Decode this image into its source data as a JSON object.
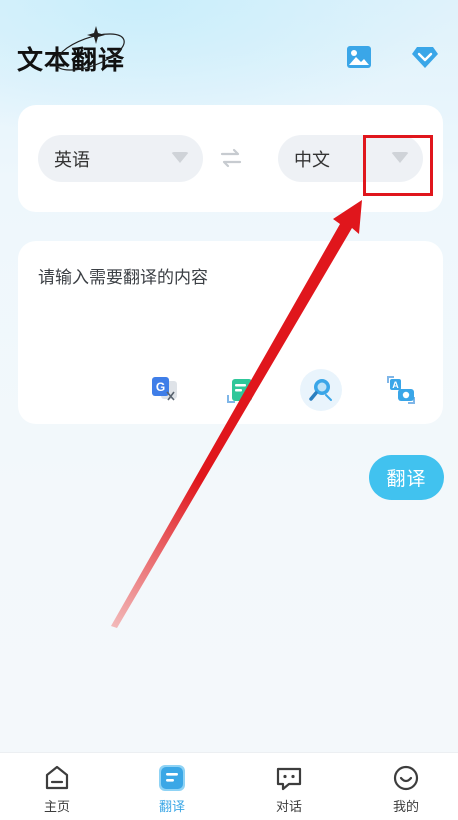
{
  "header": {
    "title": "文本翻译",
    "icons": [
      "image-icon",
      "vip-diamond-icon"
    ]
  },
  "lang_card": {
    "source_lang": "英语",
    "target_lang": "中文",
    "swap_icon": "swap-arrows-icon"
  },
  "input_card": {
    "placeholder": "请输入需要翻译的内容",
    "tools": [
      "google-translate-icon",
      "text-scan-icon",
      "search-icon",
      "photo-translate-icon"
    ]
  },
  "translate_button": {
    "label": "翻译"
  },
  "tabbar": {
    "tabs": [
      {
        "label": "主页",
        "icon": "home-icon"
      },
      {
        "label": "翻译",
        "icon": "translate-icon",
        "active": true
      },
      {
        "label": "对话",
        "icon": "chat-icon"
      },
      {
        "label": "我的",
        "icon": "profile-icon"
      }
    ]
  },
  "colors": {
    "accent": "#41c2ef",
    "annotation": "#e0161c",
    "tab_active": "#3ba7e6"
  }
}
